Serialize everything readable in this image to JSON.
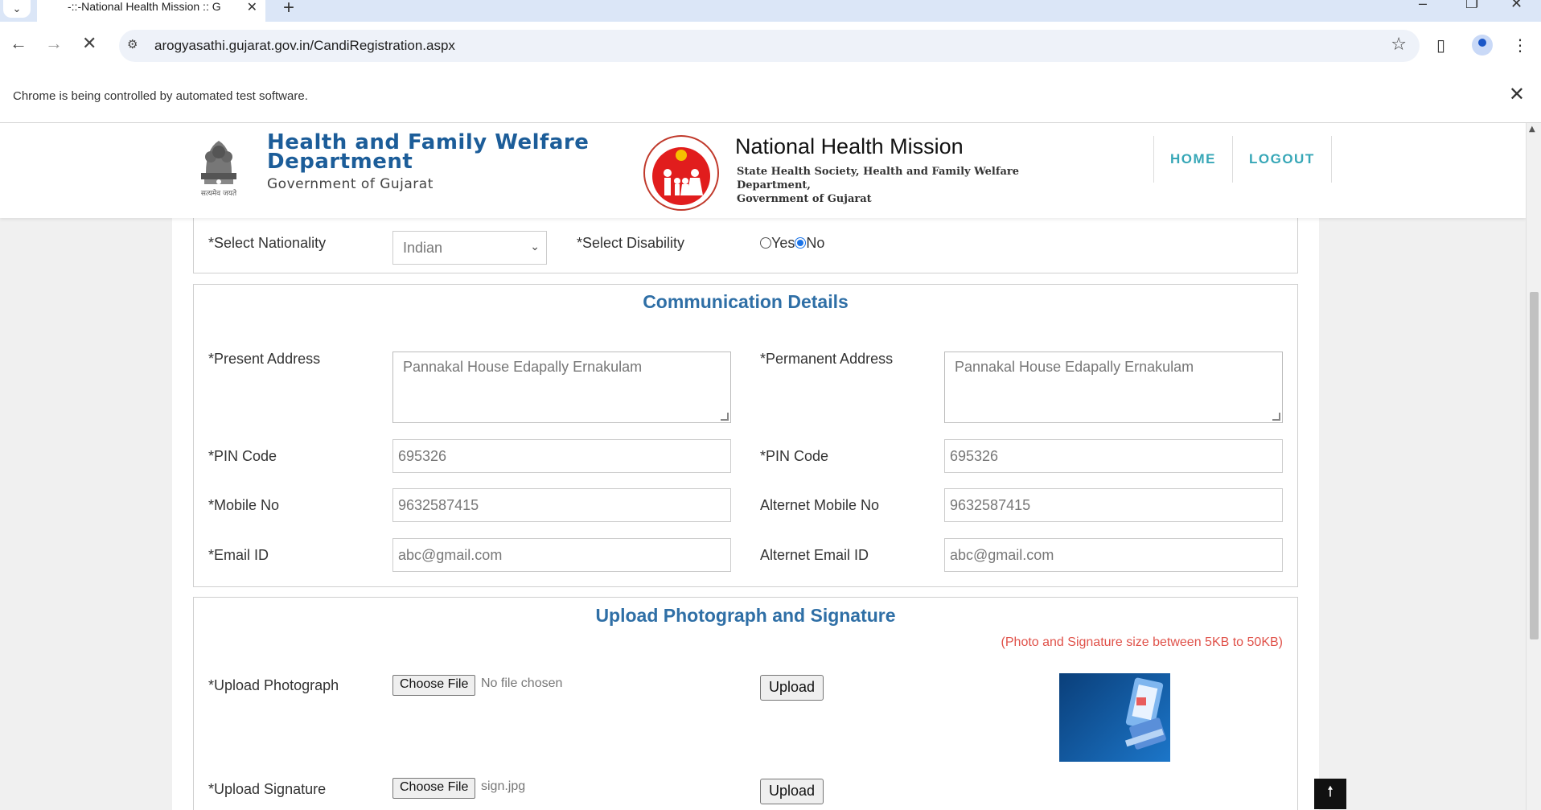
{
  "browser": {
    "tab_title": "-::-National Health Mission :: G",
    "url": "arogyasathi.gujarat.gov.in/CandiRegistration.aspx",
    "infobar_message": "Chrome is being controlled by automated test software."
  },
  "header": {
    "dept_line1": "Health and Family Welfare",
    "dept_line2": "Department",
    "dept_line3": "Government of Gujarat",
    "emblem_caption": "सत्यमेव जयते",
    "nhm_title": "National Health Mission",
    "nhm_sub_line1": "State Health Society, Health and Family Welfare Department,",
    "nhm_sub_line2": "Government of Gujarat",
    "nav": {
      "home": "HOME",
      "logout": "LOGOUT"
    }
  },
  "nationality": {
    "label": "*Select Nationality",
    "value": "Indian",
    "disability_label": "*Select Disability",
    "yes": "Yes",
    "no": "No",
    "selected": "No"
  },
  "communication": {
    "title": "Communication Details",
    "present_address_label": "*Present Address",
    "present_address": "Pannakal House Edapally Ernakulam",
    "permanent_address_label": "*Permanent Address",
    "permanent_address": "Pannakal House Edapally Ernakulam",
    "pin_label": "*PIN Code",
    "pin": "695326",
    "pin2_label": "*PIN Code",
    "pin2": "695326",
    "mobile_label": "*Mobile No",
    "mobile": "9632587415",
    "alt_mobile_label": "Alternet Mobile No",
    "alt_mobile": "9632587415",
    "email_label": "*Email ID",
    "email": "abc@gmail.com",
    "alt_email_label": "Alternet Email ID",
    "alt_email": "abc@gmail.com"
  },
  "upload": {
    "title": "Upload Photograph and Signature",
    "size_note": "(Photo and Signature size between 5KB to 50KB)",
    "photo_label": "*Upload Photograph",
    "choose_file": "Choose File",
    "photo_file": "No file chosen",
    "upload_btn": "Upload",
    "signature_label": "*Upload Signature",
    "signature_file": "sign.jpg"
  }
}
